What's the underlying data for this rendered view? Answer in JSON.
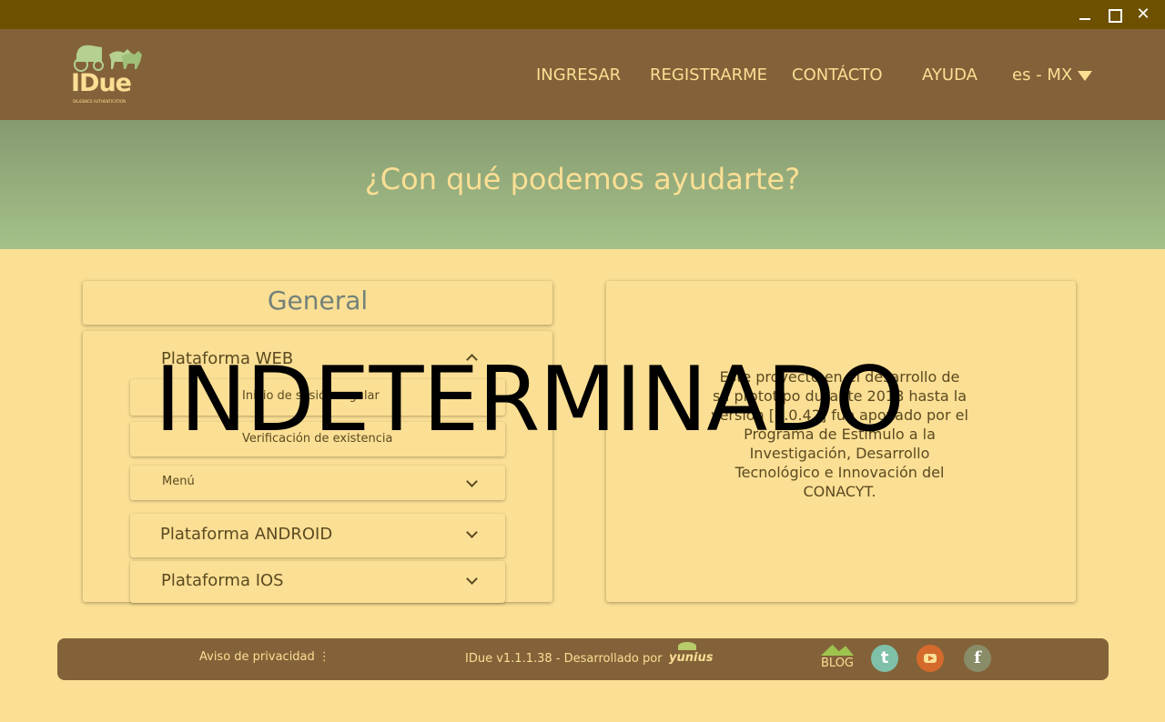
{
  "window": {
    "minimize_icon": "minimize-icon",
    "maximize_icon": "maximize-icon",
    "close_glyph": "✕"
  },
  "header": {
    "logo_text": "IDue",
    "logo_subtitle": "DILIGENCE AUTHENTICATION",
    "nav": [
      {
        "label": "INGRESAR"
      },
      {
        "label": "REGISTRARME"
      },
      {
        "label": "CONTÁCTO"
      },
      {
        "label": "AYUDA"
      }
    ],
    "language": "es - MX"
  },
  "banner": {
    "title": "¿Con qué podemos ayudarte?"
  },
  "faq": {
    "category": "General",
    "sections": [
      {
        "label": "Plataforma WEB",
        "expanded": true,
        "items": [
          {
            "label": "Inicio de sesión regular"
          },
          {
            "label": "Verificación de existencia"
          },
          {
            "label": "Menú"
          }
        ]
      },
      {
        "label": "Plataforma ANDROID",
        "expanded": false
      },
      {
        "label": "Plataforma IOS",
        "expanded": false
      }
    ]
  },
  "info": {
    "text": "Este proyecto en el desarrollo de su prototipo durante 2018 hasta la versión [0.0.42] fue apoyado por el Programa de Estímulo a la Investigación, Desarrollo Tecnológico e Innovación del CONACYT."
  },
  "overlay": {
    "text": "INDETERMINADO"
  },
  "footer": {
    "privacy": "Aviso de privacidad",
    "privacy_icon": "more-vertical-icon",
    "version": "IDue v1.1.1.38 - Desarrollado por",
    "brand": "yunius",
    "blog": "BLOG",
    "twitter_glyph": "t",
    "facebook_glyph": "f"
  },
  "colors": {
    "titlebar": "#6e5100",
    "header": "#836239",
    "accent": "#fbdf94",
    "banner_top": "#869a71",
    "banner_bottom": "#a5c189",
    "text_dark": "#5b4a21"
  }
}
